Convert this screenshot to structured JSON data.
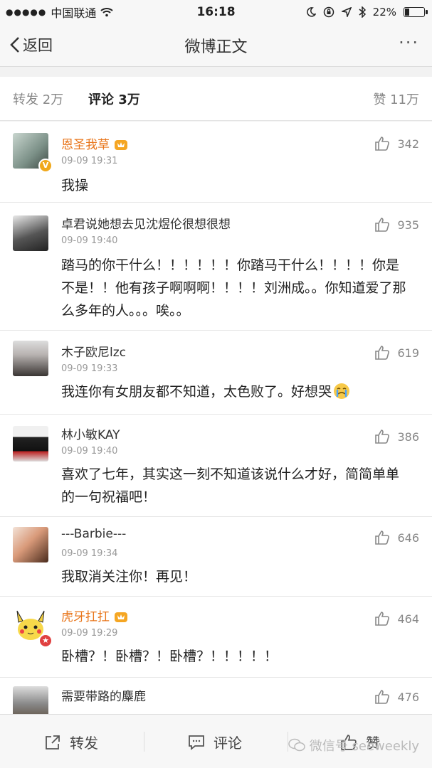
{
  "status_bar": {
    "signal_dots": "●●●●●",
    "carrier": "中国联通",
    "wifi_icon": "wifi-icon",
    "time": "16:18",
    "battery_percent": "22%",
    "battery_level": 0.22
  },
  "nav": {
    "back_label": "返回",
    "title": "微博正文",
    "more_label": "···"
  },
  "tabs": {
    "repost": {
      "label": "转发",
      "count": "2万"
    },
    "comment": {
      "label": "评论",
      "count": "3万"
    },
    "like": {
      "label": "赞",
      "count": "11万"
    }
  },
  "comments": [
    {
      "name": "恩圣我草",
      "time": "09-09 19:31",
      "text": "我操",
      "likes": "342"
    },
    {
      "name": "卓君说她想去见沈煜伦很想很想",
      "time": "09-09 19:40",
      "text": "踏马的你干什么！！！！！！你踏马干什么！！！！你是不是！！他有孩子啊啊啊！！！！刘洲成。。你知道爱了那么多年的人。。。唉。。",
      "likes": "935"
    },
    {
      "name": "木子欧尼lzc",
      "time": "09-09 19:33",
      "text": "我连你有女朋友都不知道，太色败了。好想哭",
      "likes": "619"
    },
    {
      "name": "林小敏KAY",
      "time": "09-09 19:40",
      "text": "喜欢了七年，其实这一刻不知道该说什么才好，简简单单的一句祝福吧！",
      "likes": "386"
    },
    {
      "name": "---Barbie---",
      "time": "09-09 19:34",
      "text": "我取消关注你！再见！",
      "likes": "646"
    },
    {
      "name": "虎牙扛扛",
      "time": "09-09 19:29",
      "text": "卧槽？！卧槽？！卧槽？！！！！！",
      "likes": "464"
    },
    {
      "name": "需要带路的麋鹿",
      "time": "",
      "text": "",
      "likes": "476"
    }
  ],
  "bottom_bar": {
    "repost_label": "转发",
    "comment_label": "评论",
    "like_label": "赞",
    "watermark": "微信号 seeweekly"
  },
  "colors": {
    "vip_orange": "#e8751a",
    "verified_badge": "#f0a81c",
    "red_badge": "#e04040"
  }
}
